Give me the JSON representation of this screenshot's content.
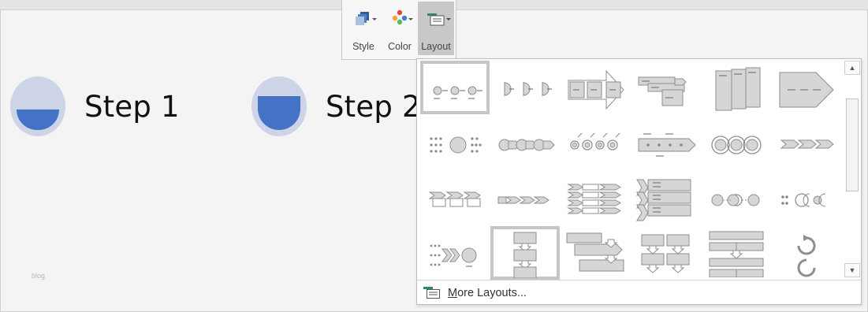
{
  "slide": {
    "steps": [
      {
        "label": "Step 1",
        "level": 0.55
      },
      {
        "label": "Step 2",
        "level": 0.8
      }
    ],
    "watermark": "blog"
  },
  "toolbar": {
    "buttons": [
      {
        "label": "Style",
        "icon": "style-icon"
      },
      {
        "label": "Color",
        "icon": "color-icon"
      },
      {
        "label": "Layout",
        "icon": "layout-icon",
        "active": true
      }
    ]
  },
  "layout_gallery": {
    "more_first": "M",
    "more_rest": "ore Layouts...",
    "selected_index": 0,
    "hover_index": 19,
    "layouts": [
      "basic-timeline",
      "circle-accent-timeline",
      "continuous-arrow-process",
      "staggered-process",
      "step-down-tabs",
      "upward-arrow",
      "circle-process-dots",
      "circle-arrow-process",
      "repeating-circle-process",
      "timeline-arrow",
      "linked-circles",
      "chevron-process",
      "interconnected-block",
      "basic-chevron",
      "accent-chevron-list",
      "vertical-chevron-list",
      "circle-alternating",
      "opposing-ideas",
      "process-dots-chevrons",
      "basic-bending-process",
      "staggered-list-arrows",
      "grid-arrows",
      "stacked-list-arrows",
      "circular-arrows"
    ],
    "colors": {
      "mark_fill": "#d6d6d6",
      "mark_stroke": "#8e8e8e",
      "selection": "#c6c6c6"
    }
  }
}
